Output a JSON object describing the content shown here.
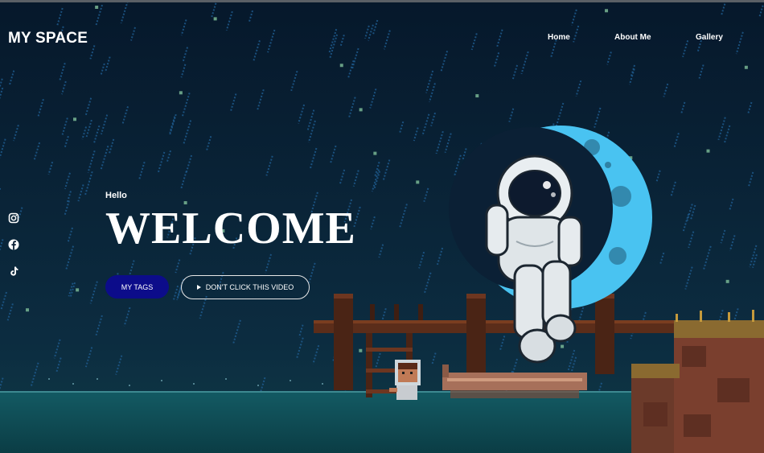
{
  "site": {
    "brand": "MY SPACE"
  },
  "nav": {
    "items": [
      {
        "label": "Home"
      },
      {
        "label": "About Me"
      },
      {
        "label": "Gallery"
      }
    ]
  },
  "social": [
    {
      "icon": "instagram-icon"
    },
    {
      "icon": "facebook-icon"
    },
    {
      "icon": "tiktok-icon"
    }
  ],
  "hero": {
    "greeting": "Hello",
    "title": "WELCOME",
    "primary_button": "MY TAGS",
    "secondary_button": "DON'T CLICK THIS VIDEO"
  },
  "colors": {
    "sky_top": "#071a30",
    "sky_bottom": "#0d3348",
    "rain": "#1e5a8c",
    "moon": "#49c3f1",
    "primary_button_bg": "#0c0c8a",
    "dock_wood": "#5b2d1a",
    "water": "#0d4a55"
  }
}
